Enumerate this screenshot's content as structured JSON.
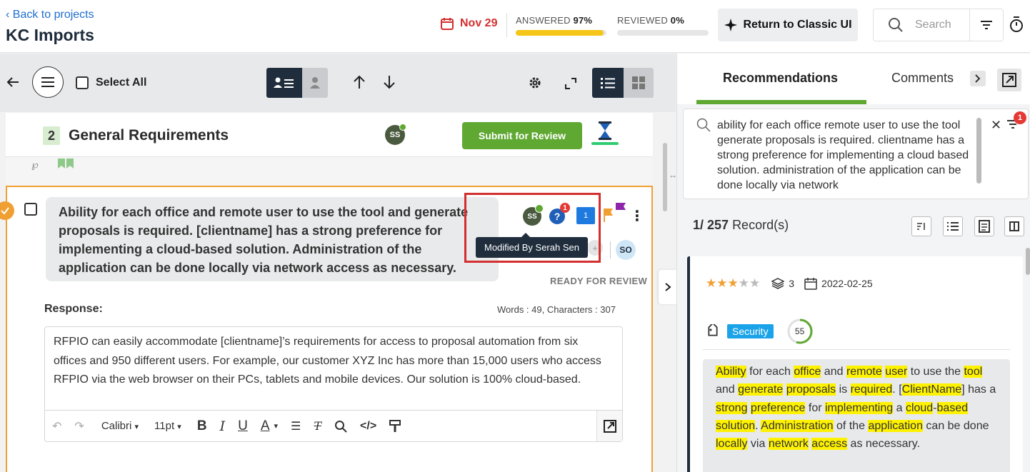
{
  "header": {
    "back_label": "Back to projects",
    "project_title": "KC Imports",
    "due_date": "Nov 29",
    "answered_label": "ANSWERED",
    "answered_value": "97%",
    "answered_fraction": 0.97,
    "reviewed_label": "REVIEWED",
    "reviewed_value": "0%",
    "reviewed_fraction": 0.0,
    "classic_ui_label": "Return to Classic UI",
    "search_placeholder": "Search"
  },
  "toolbar": {
    "select_all_label": "Select All"
  },
  "section": {
    "number": "2",
    "title": "General Requirements",
    "avatar_initials": "SS",
    "submit_label": "Submit for Review"
  },
  "question": {
    "text": "Ability for each office and remote user to use the tool and generate proposals is required.  [clientname] has a strong preference for implementing a cloud-based solution.  Administration of the application can be done locally via network access as necessary.",
    "avatar_initials": "SS",
    "help_badge": "1",
    "comment_count": "1",
    "assignee_initials": "SO",
    "tooltip": "Modified By Serah Sen",
    "status": "READY FOR REVIEW",
    "response_label": "Response:",
    "word_count": "Words : 49, Characters : 307",
    "response_text": "RFPIO can easily accommodate [clientname]’s requirements for access to proposal automation from six offices and 950 different users. For example, our customer XYZ Inc has more than 15,000 users who access RFPIO via the web browser on their PCs, tablets and mobile devices.  Our solution is 100% cloud-based.",
    "font_name": "Calibri",
    "font_size": "11pt"
  },
  "right_panel": {
    "tabs": [
      "Recommendations",
      "Comments"
    ],
    "search_text": "ability for each office remote user to use the tool generate proposals is required. clientname has a strong preference for implementing a cloud based solution. administration of the application can be done locally via network",
    "filter_badge": "1",
    "record_count_prefix": "1/ 257",
    "record_count_suffix": "Record(s)",
    "record": {
      "rating": 3,
      "rating_max": 5,
      "versions": "3",
      "date": "2022-02-25",
      "tag": "Security",
      "score": "55",
      "score_fraction": 0.55,
      "body": [
        {
          "t": "Ability",
          "h": true
        },
        {
          "t": " for each ",
          "h": false
        },
        {
          "t": "office",
          "h": true
        },
        {
          "t": " and ",
          "h": false
        },
        {
          "t": "remote",
          "h": true
        },
        {
          "t": " ",
          "h": false
        },
        {
          "t": "user",
          "h": true
        },
        {
          "t": " to use the ",
          "h": false
        },
        {
          "t": "tool",
          "h": true
        },
        {
          "t": " and ",
          "h": false
        },
        {
          "t": "generate",
          "h": true
        },
        {
          "t": " ",
          "h": false
        },
        {
          "t": "proposals",
          "h": true
        },
        {
          "t": " is ",
          "h": false
        },
        {
          "t": "required",
          "h": true
        },
        {
          "t": ". [",
          "h": false
        },
        {
          "t": "ClientName",
          "h": true
        },
        {
          "t": "] has a ",
          "h": false
        },
        {
          "t": "strong",
          "h": true
        },
        {
          "t": " ",
          "h": false
        },
        {
          "t": "preference",
          "h": true
        },
        {
          "t": " for ",
          "h": false
        },
        {
          "t": "implementing",
          "h": true
        },
        {
          "t": " a ",
          "h": false
        },
        {
          "t": "cloud",
          "h": true
        },
        {
          "t": "-",
          "h": false
        },
        {
          "t": "based",
          "h": true
        },
        {
          "t": " ",
          "h": false
        },
        {
          "t": "solution",
          "h": true
        },
        {
          "t": ". ",
          "h": false
        },
        {
          "t": "Administration",
          "h": true
        },
        {
          "t": " of the ",
          "h": false
        },
        {
          "t": "application",
          "h": true
        },
        {
          "t": " can be done ",
          "h": false
        },
        {
          "t": "locally",
          "h": true
        },
        {
          "t": " via ",
          "h": false
        },
        {
          "t": "network",
          "h": true
        },
        {
          "t": " ",
          "h": false
        },
        {
          "t": "access",
          "h": true
        },
        {
          "t": " as necessary.",
          "h": false
        }
      ]
    }
  },
  "colors": {
    "accent_green": "#5fa832",
    "accent_orange": "#f0a033",
    "due_red": "#d32f2f",
    "progress_yellow": "#f5c518",
    "navy": "#1f2d3d",
    "highlight": "#fff200",
    "tag_blue": "#1aa3e8"
  }
}
